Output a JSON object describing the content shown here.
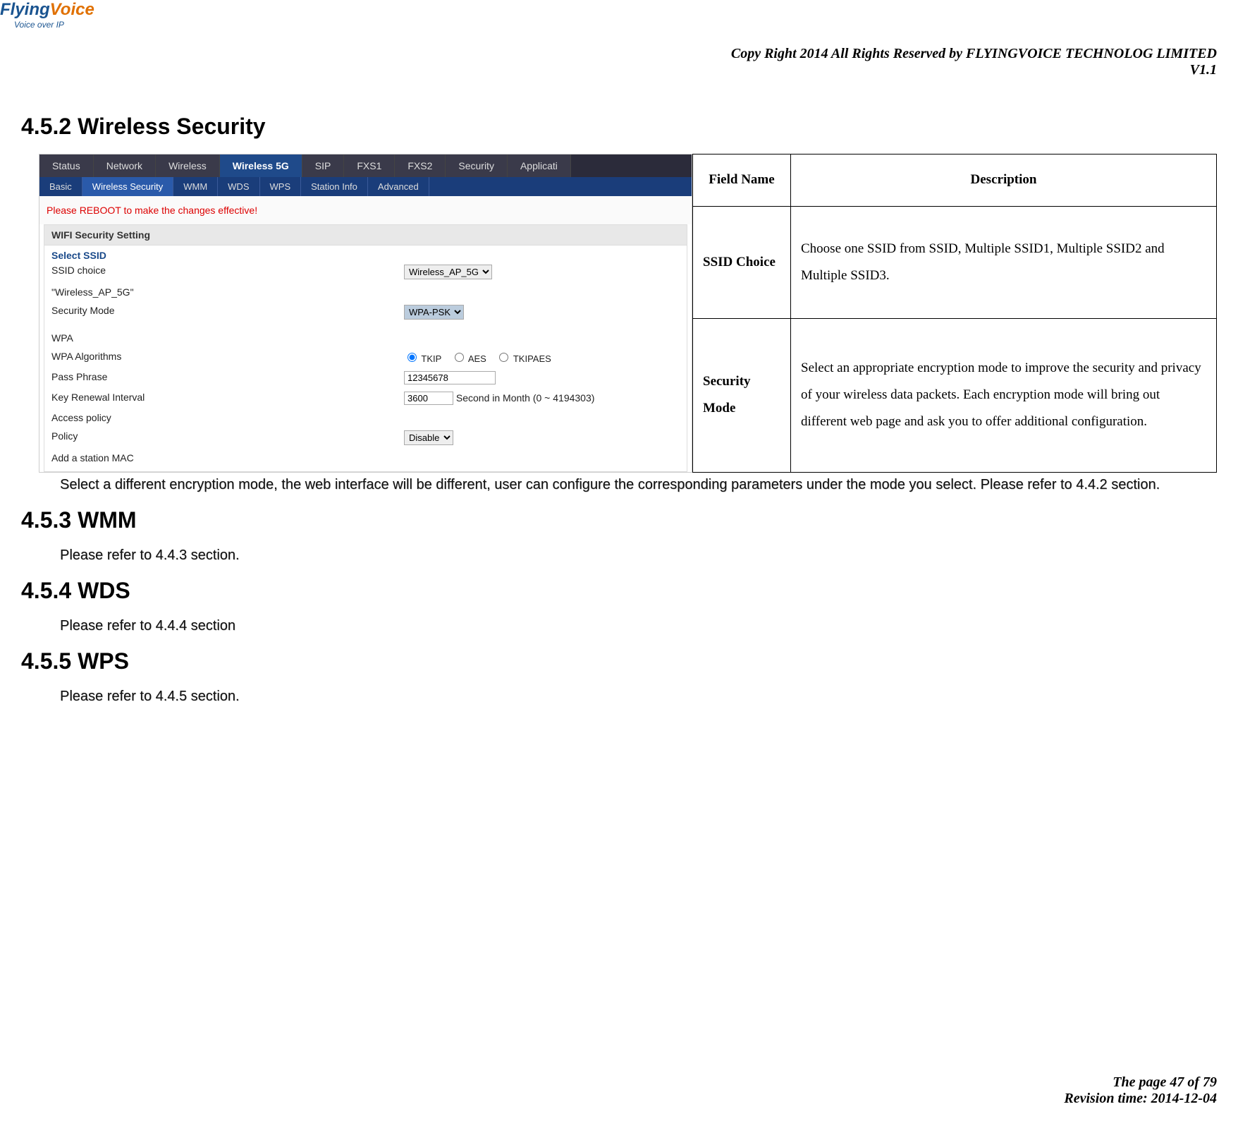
{
  "header": {
    "logo_main": "Flying",
    "logo_accent": "Voice",
    "logo_sub": "Voice over IP",
    "copyright": "Copy Right 2014 All Rights Reserved by FLYINGVOICE TECHNOLOG LIMITED",
    "version": "V1.1"
  },
  "sections": {
    "s452_title": "4.5.2 Wireless Security",
    "s453_title": "4.5.3 WMM",
    "s453_body": "Please refer to 4.4.3 section.",
    "s454_title": "4.5.4 WDS",
    "s454_body": "Please refer to 4.4.4 section",
    "s455_title": "4.5.5 WPS",
    "s455_body": "Please refer to 4.4.5 section."
  },
  "screenshot": {
    "main_tabs": {
      "t0": "Status",
      "t1": "Network",
      "t2": "Wireless",
      "t3": "Wireless 5G",
      "t4": "SIP",
      "t5": "FXS1",
      "t6": "FXS2",
      "t7": "Security",
      "t8": "Applicati"
    },
    "sub_tabs": {
      "s0": "Basic",
      "s1": "Wireless Security",
      "s2": "WMM",
      "s3": "WDS",
      "s4": "WPS",
      "s5": "Station Info",
      "s6": "Advanced"
    },
    "reboot_text": "Please REBOOT to make the changes effective!",
    "panel_title": "WIFI Security Setting",
    "select_ssid_label": "Select SSID",
    "rows": {
      "ssid_choice_label": "SSID choice",
      "ssid_choice_value": "Wireless_AP_5G",
      "ssid_name": "\"Wireless_AP_5G\"",
      "security_mode_label": "Security Mode",
      "security_mode_value": "WPA-PSK",
      "wpa_label": "WPA",
      "wpa_algo_label": "WPA Algorithms",
      "wpa_algo_opt1": "TKIP",
      "wpa_algo_opt2": "AES",
      "wpa_algo_opt3": "TKIPAES",
      "pass_label": "Pass Phrase",
      "pass_value": "12345678",
      "key_renew_label": "Key Renewal Interval",
      "key_renew_value": "3600",
      "key_renew_suffix": "Second in Month   (0 ~ 4194303)",
      "access_policy_label": "Access policy",
      "policy_label": "Policy",
      "policy_value": "Disable",
      "add_mac_label": "Add a station MAC"
    }
  },
  "desc_table": {
    "h_field": "Field Name",
    "h_desc": "Description",
    "r1_field": "SSID Choice",
    "r1_desc": "Choose one SSID from SSID, Multiple SSID1, Multiple SSID2 and Multiple SSID3.",
    "r2_field": "Security Mode",
    "r2_desc": "Select an appropriate encryption mode to improve the security and privacy of your wireless data packets.\nEach encryption mode will bring out different web page and ask you to offer additional configuration."
  },
  "note_452": "Select a different encryption mode, the web interface will be different, user can configure the corresponding parameters under the mode you select. Please refer to 4.4.2 section.",
  "footer": {
    "page": "The page 47 of 79",
    "revision": "Revision time: 2014-12-04"
  }
}
